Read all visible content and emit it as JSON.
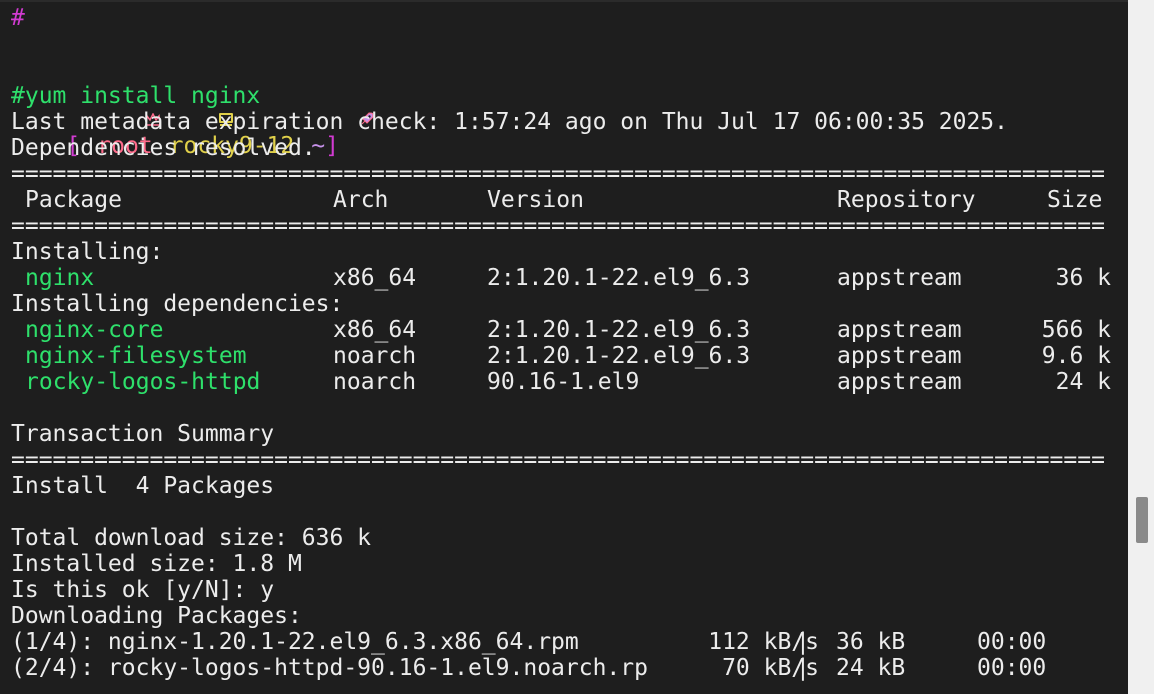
{
  "prompt_hash_line": "#",
  "prompt": {
    "open_bracket": "[",
    "crown_icon": "crown",
    "user": "root",
    "host_icon": "terminal",
    "host": "rocky9-12",
    "rocket_icon": "rocket",
    "cwd": "~",
    "close_bracket": "]"
  },
  "command": "#yum install nginx",
  "lines": {
    "metadata": "Last metadata expiration check: 1:57:24 ago on Thu Jul 17 06:00:35 2025.",
    "deps_resolved": "Dependencies resolved."
  },
  "separator": "===============================================================================",
  "table": {
    "headers": {
      "package": "Package",
      "arch": "Arch",
      "version": "Version",
      "repository": "Repository",
      "size": "Size"
    },
    "installing_label": "Installing:",
    "installing": [
      {
        "name": "nginx",
        "arch": "x86_64",
        "version": "2:1.20.1-22.el9_6.3",
        "repo": "appstream",
        "size": "36 k"
      }
    ],
    "deps_label": "Installing dependencies:",
    "dependencies": [
      {
        "name": "nginx-core",
        "arch": "x86_64",
        "version": "2:1.20.1-22.el9_6.3",
        "repo": "appstream",
        "size": "566 k"
      },
      {
        "name": "nginx-filesystem",
        "arch": "noarch",
        "version": "2:1.20.1-22.el9_6.3",
        "repo": "appstream",
        "size": "9.6 k"
      },
      {
        "name": "rocky-logos-httpd",
        "arch": "noarch",
        "version": "90.16-1.el9",
        "repo": "appstream",
        "size": "24 k"
      }
    ]
  },
  "summary": {
    "title": "Transaction Summary",
    "install": "Install  4 Packages",
    "total_download": "Total download size: 636 k",
    "installed_size": "Installed size: 1.8 M",
    "confirm": "Is this ok [y/N]: y",
    "downloading": "Downloading Packages:"
  },
  "downloads": [
    {
      "label": "(1/4): nginx-1.20.1-22.el9_6.3.x86_64.rpm",
      "speed": "112 kB/s",
      "bar": "|",
      "size": "36 kB",
      "time": "00:00"
    },
    {
      "label": "(2/4): rocky-logos-httpd-90.16-1.el9.noarch.rp",
      "speed": "70 kB/s",
      "bar": "|",
      "size": "24 kB",
      "time": "00:00"
    }
  ],
  "colors": {
    "background": "#1e1e1e",
    "text": "#ececec",
    "prompt_magenta": "#d23bd2",
    "user_pink": "#ff6b8b",
    "host_yellow": "#e0d04a",
    "command_green": "#2ee06b"
  }
}
